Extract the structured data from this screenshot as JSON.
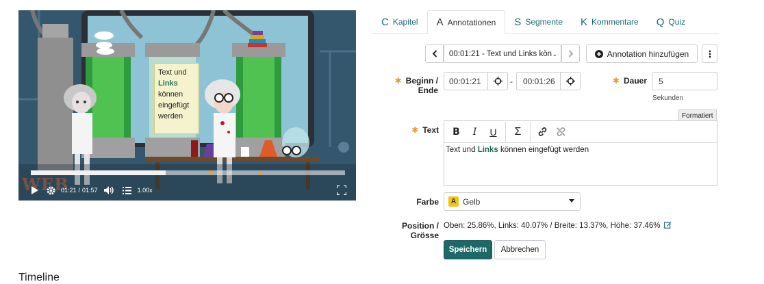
{
  "video": {
    "annotation_text_before": "Text und",
    "annotation_link": "Links",
    "annotation_text_after": "können eingefügt werden",
    "time_current": "01:21",
    "time_separator": "/",
    "time_total": "01:57",
    "speed": "1.00x",
    "watermark": "WEB",
    "progress_fraction": 0.43,
    "marker_fractions": [
      0.57,
      0.73
    ]
  },
  "tabs": [
    {
      "key": "C",
      "label": "Kapitel"
    },
    {
      "key": "A",
      "label": "Annotationen"
    },
    {
      "key": "S",
      "label": "Segmente"
    },
    {
      "key": "K",
      "label": "Kommentare"
    },
    {
      "key": "Q",
      "label": "Quiz"
    }
  ],
  "nav": {
    "selected": "00:01:21 - Text und Links kön",
    "add_label": "Annotation hinzufügen"
  },
  "form": {
    "begin_end_label": "Beginn / Ende",
    "begin_value": "00:01:21",
    "range_separator": "-",
    "end_value": "00:01:26",
    "duration_label": "Dauer",
    "duration_value": "5",
    "duration_unit": "Sekunden",
    "text_label": "Text",
    "format_badge": "Formatiert",
    "text_before": "Text und",
    "text_link": "Links",
    "text_after": "können eingefügt werden",
    "color_label": "Farbe",
    "color_letter": "A",
    "color_value": "Gelb",
    "position_label": "Position / Grösse",
    "position_value": "Oben: 25.86%, Links: 40.07% / Breite: 13.37%, Höhe: 37.46%",
    "save_label": "Speichern",
    "cancel_label": "Abbrechen"
  },
  "timeline_title": "Timeline",
  "colors": {
    "accent": "#1b6a72",
    "primary_button": "#1d6868",
    "required": "#e89a2c",
    "yellow": "#f0c419"
  },
  "icons": [
    "chevron-left-icon",
    "chevron-right-icon",
    "plus-circle-icon",
    "more-vertical-icon",
    "crosshair-icon",
    "bold-icon",
    "italic-icon",
    "underline-icon",
    "sigma-icon",
    "link-icon",
    "unlink-icon",
    "edit-icon",
    "play-icon",
    "gear-icon",
    "volume-icon",
    "list-icon",
    "fullscreen-icon",
    "caret-down-icon"
  ]
}
